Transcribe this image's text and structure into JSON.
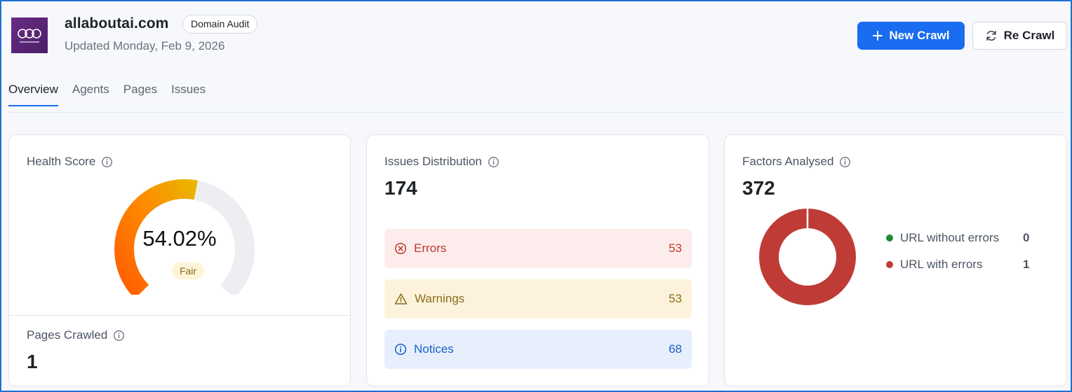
{
  "header": {
    "site": "allaboutai.com",
    "badge": "Domain Audit",
    "updated": "Updated Monday, Feb 9, 2026",
    "logo_text": "all about ai",
    "new_crawl_label": "New Crawl",
    "re_crawl_label": "Re Crawl"
  },
  "tabs": [
    {
      "label": "Overview",
      "active": true
    },
    {
      "label": "Agents",
      "active": false
    },
    {
      "label": "Pages",
      "active": false
    },
    {
      "label": "Issues",
      "active": false
    }
  ],
  "health": {
    "title": "Health Score",
    "value": "54.02%",
    "value_fraction": 0.5402,
    "rating": "Fair"
  },
  "pages_crawled": {
    "title": "Pages Crawled",
    "value": "1"
  },
  "issues": {
    "title": "Issues Distribution",
    "total": "174",
    "rows": [
      {
        "label": "Errors",
        "count": "53",
        "color": "#c0392b"
      },
      {
        "label": "Warnings",
        "count": "53",
        "color": "#8a6d1a"
      },
      {
        "label": "Notices",
        "count": "68",
        "color": "#1a5fc7"
      }
    ]
  },
  "factors": {
    "title": "Factors Analysed",
    "total": "372",
    "legend": [
      {
        "label": "URL without errors",
        "value": "0",
        "color": "#1f8a3a"
      },
      {
        "label": "URL with errors",
        "value": "1",
        "color": "#bf3b35"
      }
    ]
  },
  "colors": {
    "accent": "#1a6cf0",
    "gauge_orange": "#ff6a00",
    "gauge_yellow": "#e9b400",
    "gauge_track": "#eceef1",
    "donut_red": "#bf3b35"
  }
}
